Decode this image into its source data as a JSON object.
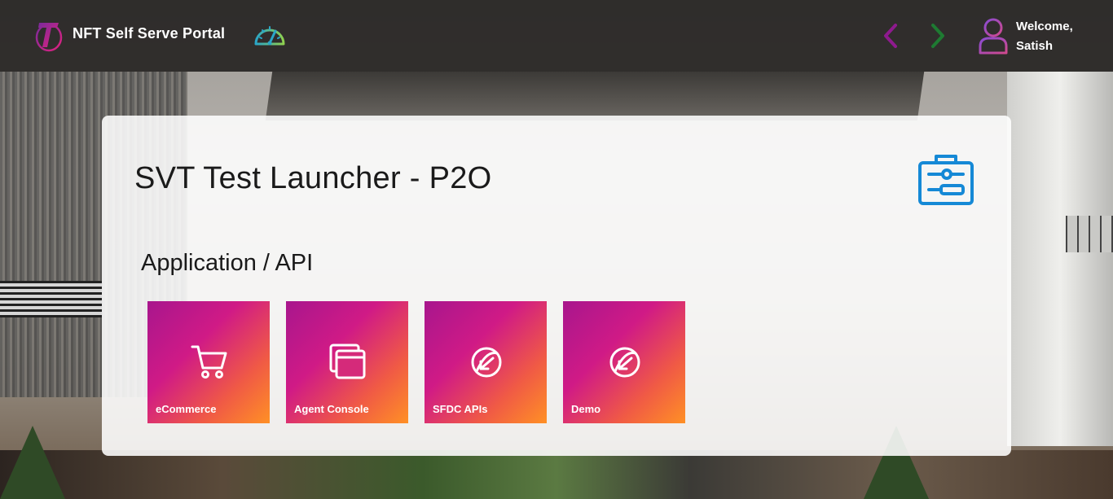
{
  "header": {
    "portal_title": "NFT Self Serve Portal",
    "welcome_line1": "Welcome,",
    "welcome_line2": "Satish",
    "icons": {
      "logo": "telstra-t-logo",
      "dashboard": "speedometer-icon",
      "back": "chevron-left-icon",
      "forward": "chevron-right-icon",
      "user": "user-avatar-icon"
    },
    "colors": {
      "back_arrow": "#8e1a8e",
      "forward_arrow": "#1e7a32",
      "accent_purple": "#a0148c",
      "accent_orange": "#ff9025"
    }
  },
  "main": {
    "title": "SVT Test Launcher - P2O",
    "header_icon": "toolbox-settings-icon",
    "section_title": "Application / API",
    "tiles": [
      {
        "label": "eCommerce",
        "icon": "shopping-cart-icon"
      },
      {
        "label": "Agent Console",
        "icon": "browser-windows-icon"
      },
      {
        "label": "SFDC APIs",
        "icon": "globe-arrow-icon"
      },
      {
        "label": "Demo",
        "icon": "globe-arrow-icon"
      }
    ]
  }
}
